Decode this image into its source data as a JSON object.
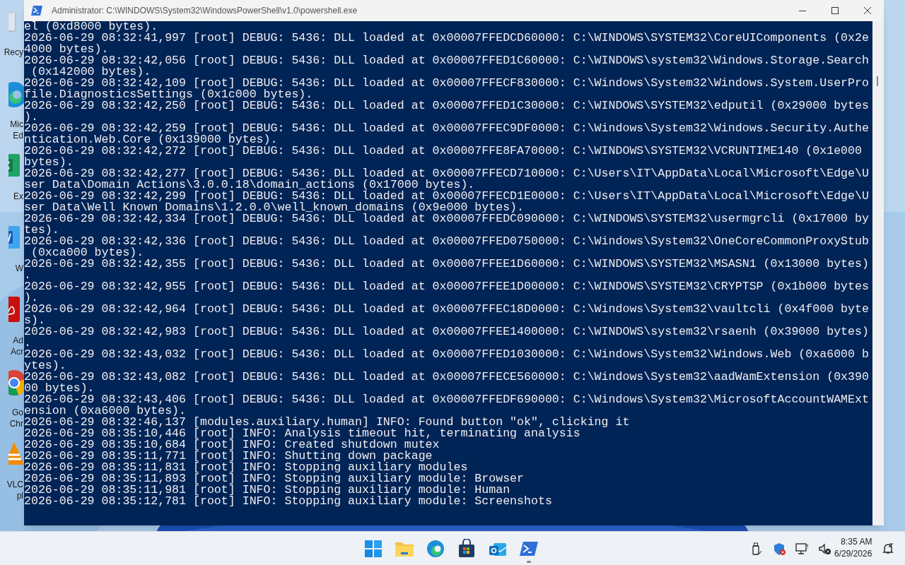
{
  "window": {
    "title": "Administrator: C:\\WINDOWS\\System32\\WindowsPowerShell\\v1.0\\powershell.exe"
  },
  "desktop_icons": [
    {
      "kind": "recycle",
      "lines": [
        "Recy"
      ]
    },
    {
      "kind": "edge",
      "lines": [
        "Mic",
        "Ed"
      ]
    },
    {
      "kind": "excel",
      "lines": [
        "Ex"
      ]
    },
    {
      "kind": "word",
      "lines": [
        "W"
      ]
    },
    {
      "kind": "acrobat",
      "lines": [
        "Ad",
        "Acr"
      ]
    },
    {
      "kind": "chrome",
      "lines": [
        "Go",
        "Chr"
      ]
    },
    {
      "kind": "vlc",
      "lines": [
        "VLC",
        "pl"
      ]
    }
  ],
  "console": {
    "lines": [
      "el (0xd8000 bytes).",
      "2026-06-29 08:32:41,997 [root] DEBUG: 5436: DLL loaded at 0x00007FFEDCD60000: C:\\WINDOWS\\SYSTEM32\\CoreUIComponents (0x2e",
      "4000 bytes).",
      "2026-06-29 08:32:42,056 [root] DEBUG: 5436: DLL loaded at 0x00007FFED1C60000: C:\\WINDOWS\\system32\\Windows.Storage.Search",
      " (0x142000 bytes).",
      "2026-06-29 08:32:42,109 [root] DEBUG: 5436: DLL loaded at 0x00007FFECF830000: C:\\Windows\\System32\\Windows.System.UserPro",
      "file.DiagnosticsSettings (0x1c000 bytes).",
      "2026-06-29 08:32:42,250 [root] DEBUG: 5436: DLL loaded at 0x00007FFED1C30000: C:\\WINDOWS\\SYSTEM32\\edputil (0x29000 bytes",
      ").",
      "2026-06-29 08:32:42,259 [root] DEBUG: 5436: DLL loaded at 0x00007FFEC9DF0000: C:\\Windows\\System32\\Windows.Security.Authe",
      "ntication.Web.Core (0x139000 bytes).",
      "2026-06-29 08:32:42,272 [root] DEBUG: 5436: DLL loaded at 0x00007FFE8FA70000: C:\\WINDOWS\\SYSTEM32\\VCRUNTIME140 (0x1e000",
      "bytes).",
      "2026-06-29 08:32:42,277 [root] DEBUG: 5436: DLL loaded at 0x00007FFECD710000: C:\\Users\\IT\\AppData\\Local\\Microsoft\\Edge\\U",
      "ser Data\\Domain Actions\\3.0.0.18\\domain_actions (0x17000 bytes).",
      "2026-06-29 08:32:42,299 [root] DEBUG: 5436: DLL loaded at 0x00007FFECD1E0000: C:\\Users\\IT\\AppData\\Local\\Microsoft\\Edge\\U",
      "ser Data\\Well Known Domains\\1.2.0.0\\well_known_domains (0x9e000 bytes).",
      "2026-06-29 08:32:42,334 [root] DEBUG: 5436: DLL loaded at 0x00007FFEDC090000: C:\\WINDOWS\\SYSTEM32\\usermgrcli (0x17000 by",
      "tes).",
      "2026-06-29 08:32:42,336 [root] DEBUG: 5436: DLL loaded at 0x00007FFED0750000: C:\\Windows\\System32\\OneCoreCommonProxyStub",
      " (0xca000 bytes).",
      "2026-06-29 08:32:42,355 [root] DEBUG: 5436: DLL loaded at 0x00007FFEE1D60000: C:\\WINDOWS\\SYSTEM32\\MSASN1 (0x13000 bytes)",
      ".",
      "2026-06-29 08:32:42,955 [root] DEBUG: 5436: DLL loaded at 0x00007FFEE1D00000: C:\\WINDOWS\\SYSTEM32\\CRYPTSP (0x1b000 bytes",
      ").",
      "2026-06-29 08:32:42,964 [root] DEBUG: 5436: DLL loaded at 0x00007FFEC18D0000: C:\\Windows\\System32\\vaultcli (0x4f000 byte",
      "s).",
      "2026-06-29 08:32:42,983 [root] DEBUG: 5436: DLL loaded at 0x00007FFEE1400000: C:\\WINDOWS\\system32\\rsaenh (0x39000 bytes)",
      ".",
      "2026-06-29 08:32:43,032 [root] DEBUG: 5436: DLL loaded at 0x00007FFED1030000: C:\\Windows\\System32\\Windows.Web (0xa6000 b",
      "ytes).",
      "2026-06-29 08:32:43,082 [root] DEBUG: 5436: DLL loaded at 0x00007FFECE560000: C:\\Windows\\System32\\aadWamExtension (0x390",
      "00 bytes).",
      "2026-06-29 08:32:43,406 [root] DEBUG: 5436: DLL loaded at 0x00007FFEDF690000: C:\\Windows\\System32\\MicrosoftAccountWAMExt",
      "ension (0xa6000 bytes).",
      "2026-06-29 08:32:46,137 [modules.auxiliary.human] INFO: Found button \"ok\", clicking it",
      "2026-06-29 08:35:10,446 [root] INFO: Analysis timeout hit, terminating analysis",
      "2026-06-29 08:35:10,684 [root] INFO: Created shutdown mutex",
      "2026-06-29 08:35:11,771 [root] INFO: Shutting down package",
      "2026-06-29 08:35:11,831 [root] INFO: Stopping auxiliary modules",
      "2026-06-29 08:35:11,893 [root] INFO: Stopping auxiliary module: Browser",
      "2026-06-29 08:35:11,981 [root] INFO: Stopping auxiliary module: Human",
      "2026-06-29 08:35:12,781 [root] INFO: Stopping auxiliary module: Screenshots"
    ]
  },
  "taskbar": {
    "apps": [
      {
        "kind": "start",
        "active": false
      },
      {
        "kind": "explorer",
        "active": false
      },
      {
        "kind": "edge",
        "active": false
      },
      {
        "kind": "store",
        "active": false
      },
      {
        "kind": "outlook",
        "active": false
      },
      {
        "kind": "powershell",
        "active": true
      }
    ],
    "tray": [
      {
        "kind": "usb"
      },
      {
        "kind": "defender"
      },
      {
        "kind": "network"
      },
      {
        "kind": "volume"
      }
    ],
    "clock": {
      "time": "8:35 AM",
      "date": "6/29/2026"
    }
  }
}
